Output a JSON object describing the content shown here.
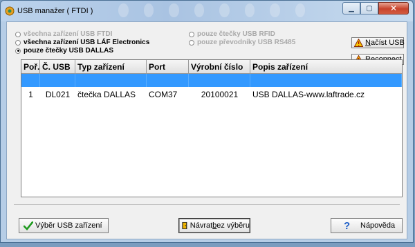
{
  "window": {
    "title": "USB manažer ( FTDI )"
  },
  "filters": {
    "left": [
      {
        "label": "všechna zařízení USB FTDI",
        "selected": false,
        "enabled": false
      },
      {
        "label": "všechna zařízení USB LÁF Electronics",
        "selected": false,
        "enabled": true
      },
      {
        "label": "pouze čtečky USB DALLAS",
        "selected": true,
        "enabled": true
      }
    ],
    "right": [
      {
        "label": "pouze čtečky USB RFID",
        "selected": false,
        "enabled": false
      },
      {
        "label": "pouze převodníky USB RS485",
        "selected": false,
        "enabled": false
      }
    ]
  },
  "side_buttons": {
    "load_usb": {
      "prefix": "N",
      "rest": "ačíst USB",
      "icon": "warning-icon"
    },
    "reconnect": {
      "prefix": "R",
      "rest": "econnect",
      "icon": "warning-icon"
    }
  },
  "table": {
    "columns": [
      "Poř.",
      "Č. USB",
      "Typ zařízení",
      "Port",
      "Výrobní číslo",
      "Popis zařízení"
    ],
    "rows": [
      [
        "1",
        "DL021",
        "čtečka DALLAS",
        "COM37",
        "20100021",
        "USB DALLAS-www.laftrade.cz"
      ]
    ]
  },
  "buttons": {
    "select_usb": "Výběr USB zařízení",
    "back_pre": "Návrat ",
    "back_underline": "b",
    "back_post": "ez výběru",
    "help": "Nápověda"
  },
  "colors": {
    "selection": "#3399ff",
    "close_button": "#c7432c"
  }
}
